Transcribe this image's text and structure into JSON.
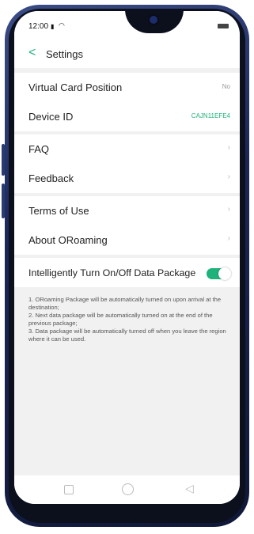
{
  "status_bar": {
    "time": "12:00",
    "signal_text": "ᵗıl"
  },
  "header": {
    "back_glyph": "<",
    "title": "Settings"
  },
  "settings_group_1": [
    {
      "label": "Virtual Card Position",
      "value": "No"
    },
    {
      "label": "Device ID",
      "value": "CAJN11EFE4"
    }
  ],
  "settings_group_2": [
    {
      "label": "FAQ"
    },
    {
      "label": "Feedback"
    }
  ],
  "settings_group_3": [
    {
      "label": "Terms of Use"
    },
    {
      "label": "About ORoaming"
    }
  ],
  "data_package_toggle": {
    "label": "Intelligently Turn On/Off Data Package",
    "enabled": true,
    "accent_color": "#1fb27a"
  },
  "notes": [
    "1. ORoaming Package will be automatically turned on upon arrival at the destination;",
    "2. Next data package will be automatically turned on at the end of the previous package;",
    "3. Data package will be automatically turned off when you leave the region where it can be used."
  ]
}
